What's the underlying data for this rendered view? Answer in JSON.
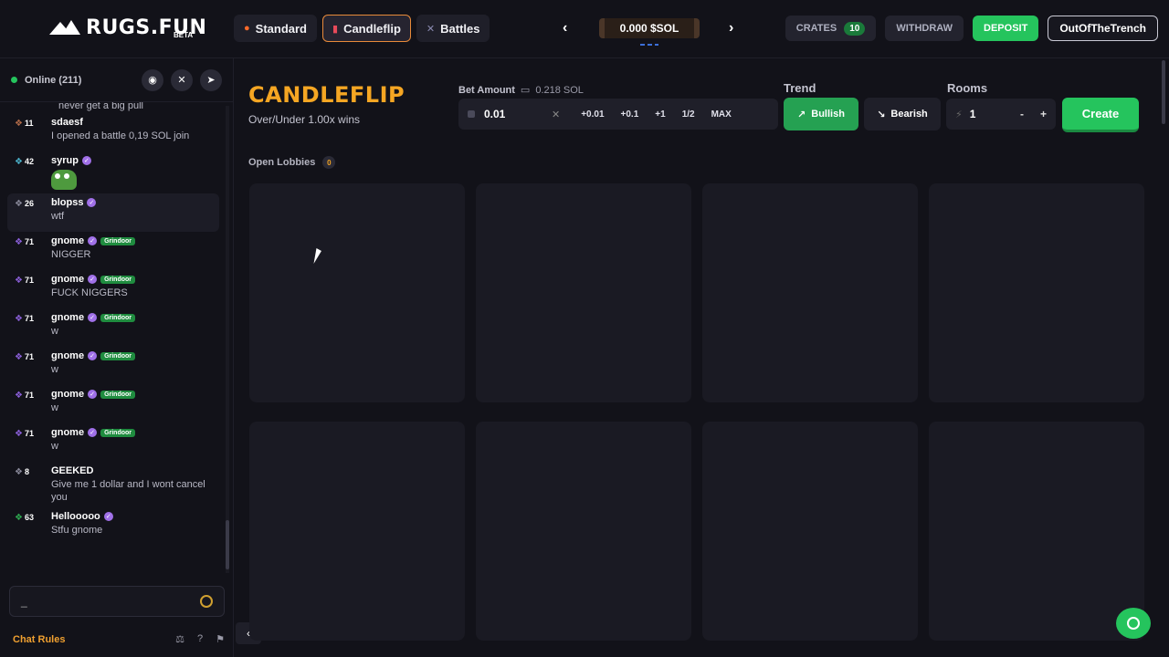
{
  "header": {
    "logo": "RUGS.FUN",
    "logo_badge": "BETA",
    "tabs": [
      {
        "label": "Standard",
        "icon": "flame-icon"
      },
      {
        "label": "Candleflip",
        "icon": "candle-icon",
        "active": true
      },
      {
        "label": "Battles",
        "icon": "swords-icon"
      }
    ],
    "balance": "0.000 $SOL",
    "crates_label": "CRATES",
    "crates_count": "10",
    "withdraw_label": "WITHDRAW",
    "deposit_label": "DEPOSIT",
    "username": "OutOfTheTrench"
  },
  "sidebar": {
    "online": "Online (211)",
    "messages": [
      {
        "level": "11",
        "name": "sdaesf",
        "text": "I opened a battle 0,19 SOL join",
        "color": "brown"
      },
      {
        "level": "42",
        "name": "syrup",
        "verified": true,
        "emote": "pepe",
        "color": "teal"
      },
      {
        "level": "26",
        "name": "blopss",
        "verified": true,
        "text": "wtf",
        "color": "grey",
        "highlight": true
      },
      {
        "level": "71",
        "name": "gnome",
        "verified": true,
        "tag": "Grindoor",
        "text": "NIGGER",
        "color": "purple"
      },
      {
        "level": "71",
        "name": "gnome",
        "verified": true,
        "tag": "Grindoor",
        "text": "FUCK NIGGERS",
        "color": "purple"
      },
      {
        "level": "71",
        "name": "gnome",
        "verified": true,
        "tag": "Grindoor",
        "text": "w",
        "color": "purple"
      },
      {
        "level": "71",
        "name": "gnome",
        "verified": true,
        "tag": "Grindoor",
        "text": "w",
        "color": "purple"
      },
      {
        "level": "71",
        "name": "gnome",
        "verified": true,
        "tag": "Grindoor",
        "text": "w",
        "color": "purple"
      },
      {
        "level": "71",
        "name": "gnome",
        "verified": true,
        "tag": "Grindoor",
        "text": "w",
        "color": "purple"
      },
      {
        "level": "8",
        "name": "GEEKED",
        "text": "Give me 1 dollar and I wont cancel you",
        "color": "grey"
      },
      {
        "level": "63",
        "name": "Hellooooo",
        "verified": true,
        "text": "Stfu gnome",
        "color": "green"
      }
    ],
    "partial_message_top": "never get a big pull",
    "chat_input_value": "_",
    "chat_rules": "Chat Rules"
  },
  "main": {
    "title": "CANDLEFLIP",
    "subtitle": "Over/Under 1.00x wins",
    "bet_label": "Bet Amount",
    "bet_balance": "0.218 SOL",
    "bet_value": "0.01",
    "quick_buttons": [
      "+0.01",
      "+0.1",
      "+1",
      "1/2",
      "MAX"
    ],
    "trend_label": "Trend",
    "bullish": "Bullish",
    "bearish": "Bearish",
    "rooms_label": "Rooms",
    "rooms_value": "1",
    "minus": "-",
    "plus": "+",
    "create_label": "Create",
    "open_lobbies": "Open Lobbies",
    "open_lobbies_count": "0",
    "lobby_cards": 8
  },
  "colors": {
    "accent": "#f5a623",
    "green": "#25c45d",
    "bg": "#121219",
    "card": "#1a1a23"
  }
}
